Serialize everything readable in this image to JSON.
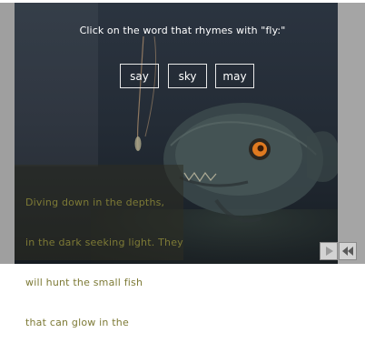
{
  "quiz": {
    "prompt": "Click on the word that rhymes with \"fly:\"",
    "choices": [
      "say",
      "sky",
      "may"
    ]
  },
  "story": {
    "lines": [
      "Diving down in the depths,",
      "in the dark seeking light. They",
      "will hunt the small fish",
      "that can glow in the"
    ]
  },
  "nav": {
    "icons": [
      "play-icon",
      "rewind-icon"
    ]
  },
  "colors": {
    "side_panel": "#9f9f9f",
    "scene_dark": "#242c36",
    "story_text": "#7d7a36",
    "fish_eye": "#e07a20"
  }
}
